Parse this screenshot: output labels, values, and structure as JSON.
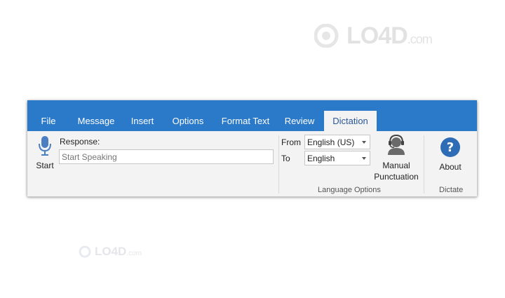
{
  "watermark": {
    "brand": "LO4D",
    "suffix": ".com"
  },
  "ribbon": {
    "tabs": [
      "File",
      "Message",
      "Insert",
      "Options",
      "Format Text",
      "Review",
      "Dictation"
    ],
    "active_tab": "Dictation",
    "accent_color": "#2b79c9"
  },
  "dictation": {
    "start_label": "Start",
    "response_label": "Response:",
    "response_placeholder": "Start Speaking"
  },
  "language_options": {
    "from_label": "From",
    "from_value": "English (US)",
    "to_label": "To",
    "to_value": "English",
    "manual_punctuation_line1": "Manual",
    "manual_punctuation_line2": "Punctuation",
    "group_label": "Language Options"
  },
  "dictate_group": {
    "about_label": "About",
    "group_label": "Dictate"
  },
  "icons": {
    "microphone": "microphone-icon",
    "headset": "headset-icon",
    "help": "help-icon"
  }
}
